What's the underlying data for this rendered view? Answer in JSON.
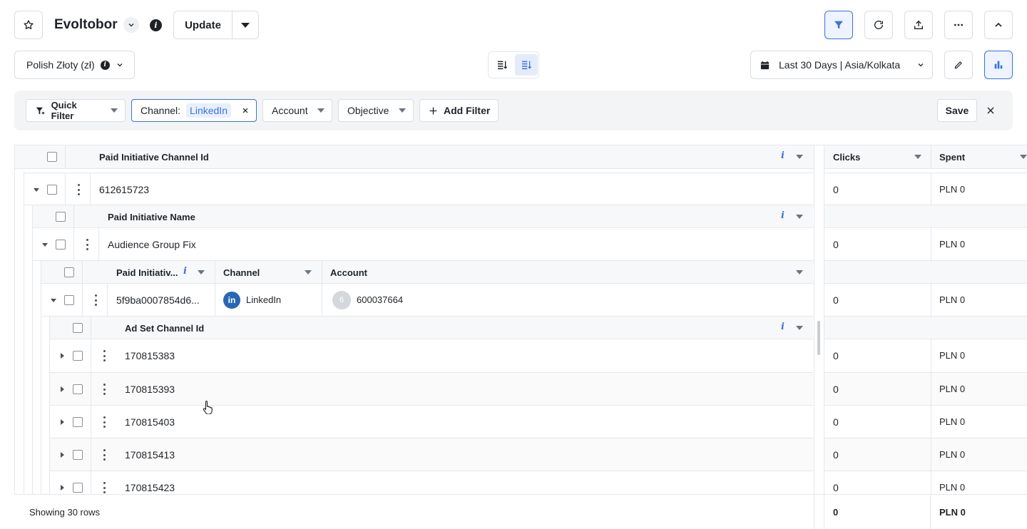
{
  "header": {
    "title": "Evoltobor",
    "update_label": "Update",
    "currency_label": "Polish Złoty (zł)",
    "date_range_label": "Last 30 Days | Asia/Kolkata"
  },
  "filters": {
    "quick_filter_label": "Quick Filter",
    "channel_label": "Channel:",
    "channel_value": "LinkedIn",
    "account_label": "Account",
    "objective_label": "Objective",
    "add_filter_label": "Add Filter",
    "save_label": "Save"
  },
  "table": {
    "top_header": "Paid Initiative Channel Id",
    "right_headers": [
      "Clicks",
      "Spent"
    ],
    "level1": {
      "id": "612615723",
      "clicks": "0",
      "spent": "PLN 0"
    },
    "level2_header": "Paid Initiative Name",
    "level2": {
      "name": "Audience Group Fix",
      "clicks": "0",
      "spent": "PLN 0"
    },
    "level3_headers": [
      "Paid Initiativ...",
      "Channel",
      "Account"
    ],
    "level3": {
      "id": "5f9ba0007854d6...",
      "channel": "LinkedIn",
      "channel_icon": "in",
      "account_badge": "6",
      "account": "600037664",
      "clicks": "0",
      "spent": "PLN 0"
    },
    "level4_header": "Ad Set Channel Id",
    "adsets": [
      {
        "id": "170815383",
        "clicks": "0",
        "spent": "PLN 0"
      },
      {
        "id": "170815393",
        "clicks": "0",
        "spent": "PLN 0"
      },
      {
        "id": "170815403",
        "clicks": "0",
        "spent": "PLN 0"
      },
      {
        "id": "170815413",
        "clicks": "0",
        "spent": "PLN 0"
      },
      {
        "id": "170815423",
        "clicks": "0",
        "spent": "PLN 0"
      }
    ],
    "footer": {
      "showing": "Showing 30 rows",
      "clicks_total": "0",
      "spent_total": "PLN 0"
    }
  },
  "colors": {
    "accent": "#3b73d9",
    "linkedin": "#2867b2",
    "filter_bar_bg": "#f3f4f6"
  }
}
